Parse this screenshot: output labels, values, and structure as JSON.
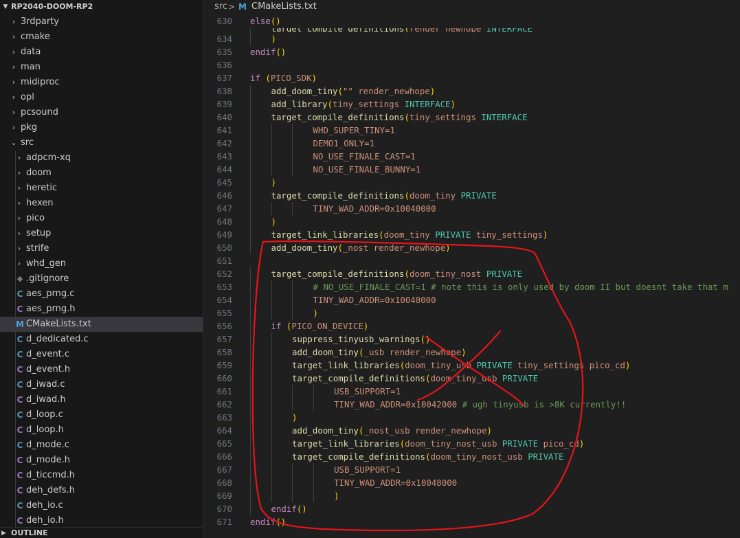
{
  "sidebar": {
    "project_name": "RP2040-DOOM-RP2",
    "outline_label": "OUTLINE",
    "items": [
      {
        "label": "3rdparty",
        "kind": "folder",
        "open": false,
        "depth": 0
      },
      {
        "label": "cmake",
        "kind": "folder",
        "open": false,
        "depth": 0
      },
      {
        "label": "data",
        "kind": "folder",
        "open": false,
        "depth": 0
      },
      {
        "label": "man",
        "kind": "folder",
        "open": false,
        "depth": 0
      },
      {
        "label": "midiproc",
        "kind": "folder",
        "open": false,
        "depth": 0
      },
      {
        "label": "opl",
        "kind": "folder",
        "open": false,
        "depth": 0
      },
      {
        "label": "pcsound",
        "kind": "folder",
        "open": false,
        "depth": 0
      },
      {
        "label": "pkg",
        "kind": "folder",
        "open": false,
        "depth": 0
      },
      {
        "label": "src",
        "kind": "folder",
        "open": true,
        "depth": 0
      },
      {
        "label": "adpcm-xq",
        "kind": "folder",
        "open": false,
        "depth": 1
      },
      {
        "label": "doom",
        "kind": "folder",
        "open": false,
        "depth": 1
      },
      {
        "label": "heretic",
        "kind": "folder",
        "open": false,
        "depth": 1
      },
      {
        "label": "hexen",
        "kind": "folder",
        "open": false,
        "depth": 1
      },
      {
        "label": "pico",
        "kind": "folder",
        "open": false,
        "depth": 1
      },
      {
        "label": "setup",
        "kind": "folder",
        "open": false,
        "depth": 1
      },
      {
        "label": "strife",
        "kind": "folder",
        "open": false,
        "depth": 1
      },
      {
        "label": "whd_gen",
        "kind": "folder",
        "open": false,
        "depth": 1
      },
      {
        "label": ".gitignore",
        "kind": "git",
        "icon": "gitignore-icon",
        "depth": 1
      },
      {
        "label": "aes_prng.c",
        "kind": "c",
        "icon_text": "C",
        "depth": 1
      },
      {
        "label": "aes_prng.h",
        "kind": "h",
        "icon_text": "C",
        "depth": 1
      },
      {
        "label": "CMakeLists.txt",
        "kind": "m",
        "icon_text": "M",
        "depth": 1,
        "selected": true
      },
      {
        "label": "d_dedicated.c",
        "kind": "c",
        "icon_text": "C",
        "depth": 1
      },
      {
        "label": "d_event.c",
        "kind": "c",
        "icon_text": "C",
        "depth": 1
      },
      {
        "label": "d_event.h",
        "kind": "h",
        "icon_text": "C",
        "depth": 1
      },
      {
        "label": "d_iwad.c",
        "kind": "c",
        "icon_text": "C",
        "depth": 1
      },
      {
        "label": "d_iwad.h",
        "kind": "h",
        "icon_text": "C",
        "depth": 1
      },
      {
        "label": "d_loop.c",
        "kind": "c",
        "icon_text": "C",
        "depth": 1
      },
      {
        "label": "d_loop.h",
        "kind": "h",
        "icon_text": "C",
        "depth": 1
      },
      {
        "label": "d_mode.c",
        "kind": "c",
        "icon_text": "C",
        "depth": 1
      },
      {
        "label": "d_mode.h",
        "kind": "h",
        "icon_text": "C",
        "depth": 1
      },
      {
        "label": "d_ticcmd.h",
        "kind": "h",
        "icon_text": "C",
        "depth": 1
      },
      {
        "label": "deh_defs.h",
        "kind": "h",
        "icon_text": "C",
        "depth": 1
      },
      {
        "label": "deh_io.c",
        "kind": "c",
        "icon_text": "C",
        "depth": 1
      },
      {
        "label": "deh_io.h",
        "kind": "h",
        "icon_text": "C",
        "depth": 1
      }
    ]
  },
  "breadcrumb": {
    "folder": "src",
    "separator": ">",
    "icon_text": "M",
    "file": "CMakeLists.txt"
  },
  "code_lines": [
    {
      "n": "630",
      "indent": 0,
      "tokens": [
        {
          "t": "else",
          "c": "kw"
        },
        {
          "t": "()",
          "c": "par"
        }
      ]
    },
    {
      "n": "",
      "indent": 4,
      "partial": true,
      "tokens": [
        {
          "t": "target_compile_definitions",
          "c": "fn"
        },
        {
          "t": "(",
          "c": "par"
        },
        {
          "t": "render_newhope ",
          "c": "arg"
        },
        {
          "t": "INTERFACE",
          "c": "con"
        }
      ]
    },
    {
      "n": "634",
      "indent": 4,
      "tokens": [
        {
          "t": ")",
          "c": "par"
        }
      ]
    },
    {
      "n": "635",
      "indent": 0,
      "tokens": [
        {
          "t": "endif",
          "c": "kw"
        },
        {
          "t": "()",
          "c": "par"
        }
      ]
    },
    {
      "n": "636",
      "indent": 0,
      "tokens": []
    },
    {
      "n": "637",
      "indent": 0,
      "tokens": [
        {
          "t": "if ",
          "c": "kw"
        },
        {
          "t": "(",
          "c": "par"
        },
        {
          "t": "PICO_SDK",
          "c": "arg"
        },
        {
          "t": ")",
          "c": "par"
        }
      ]
    },
    {
      "n": "638",
      "indent": 4,
      "tokens": [
        {
          "t": "add_doom_tiny",
          "c": "fn"
        },
        {
          "t": "(",
          "c": "par"
        },
        {
          "t": "\"\"",
          "c": "str"
        },
        {
          "t": " render_newhope",
          "c": "arg"
        },
        {
          "t": ")",
          "c": "par"
        }
      ]
    },
    {
      "n": "639",
      "indent": 4,
      "tokens": [
        {
          "t": "add_library",
          "c": "fn"
        },
        {
          "t": "(",
          "c": "par"
        },
        {
          "t": "tiny_settings ",
          "c": "arg"
        },
        {
          "t": "INTERFACE",
          "c": "con"
        },
        {
          "t": ")",
          "c": "par"
        }
      ]
    },
    {
      "n": "640",
      "indent": 4,
      "tokens": [
        {
          "t": "target_compile_definitions",
          "c": "fn"
        },
        {
          "t": "(",
          "c": "par"
        },
        {
          "t": "tiny_settings ",
          "c": "arg"
        },
        {
          "t": "INTERFACE",
          "c": "con"
        }
      ]
    },
    {
      "n": "641",
      "indent": 12,
      "tokens": [
        {
          "t": "WHD_SUPER_TINY=1",
          "c": "arg"
        }
      ]
    },
    {
      "n": "642",
      "indent": 12,
      "tokens": [
        {
          "t": "DEMO1_ONLY=1",
          "c": "arg"
        }
      ]
    },
    {
      "n": "643",
      "indent": 12,
      "tokens": [
        {
          "t": "NO_USE_FINALE_CAST=1",
          "c": "arg"
        }
      ]
    },
    {
      "n": "644",
      "indent": 12,
      "tokens": [
        {
          "t": "NO_USE_FINALE_BUNNY=1",
          "c": "arg"
        }
      ]
    },
    {
      "n": "645",
      "indent": 4,
      "tokens": [
        {
          "t": ")",
          "c": "par"
        }
      ]
    },
    {
      "n": "646",
      "indent": 4,
      "tokens": [
        {
          "t": "target_compile_definitions",
          "c": "fn"
        },
        {
          "t": "(",
          "c": "par"
        },
        {
          "t": "doom_tiny ",
          "c": "arg"
        },
        {
          "t": "PRIVATE",
          "c": "con"
        }
      ]
    },
    {
      "n": "647",
      "indent": 12,
      "tokens": [
        {
          "t": "TINY_WAD_ADDR=0x10040000",
          "c": "arg"
        }
      ]
    },
    {
      "n": "648",
      "indent": 4,
      "tokens": [
        {
          "t": ")",
          "c": "par"
        }
      ]
    },
    {
      "n": "649",
      "indent": 4,
      "tokens": [
        {
          "t": "target_link_libraries",
          "c": "fn"
        },
        {
          "t": "(",
          "c": "par"
        },
        {
          "t": "doom_tiny ",
          "c": "arg"
        },
        {
          "t": "PRIVATE",
          "c": "con"
        },
        {
          "t": " tiny_settings",
          "c": "arg"
        },
        {
          "t": ")",
          "c": "par"
        }
      ]
    },
    {
      "n": "650",
      "indent": 4,
      "tokens": [
        {
          "t": "add_doom_tiny",
          "c": "fn"
        },
        {
          "t": "(",
          "c": "par"
        },
        {
          "t": "_nost render_newhope",
          "c": "arg"
        },
        {
          "t": ")",
          "c": "par"
        }
      ]
    },
    {
      "n": "651",
      "indent": 0,
      "tokens": []
    },
    {
      "n": "652",
      "indent": 4,
      "tokens": [
        {
          "t": "target_compile_definitions",
          "c": "fn"
        },
        {
          "t": "(",
          "c": "par"
        },
        {
          "t": "doom_tiny_nost ",
          "c": "arg"
        },
        {
          "t": "PRIVATE",
          "c": "con"
        }
      ]
    },
    {
      "n": "653",
      "indent": 12,
      "tokens": [
        {
          "t": "# NO_USE_FINALE_CAST=1 # note this is only used by doom II but doesnt take that m",
          "c": "cmt"
        }
      ]
    },
    {
      "n": "654",
      "indent": 12,
      "tokens": [
        {
          "t": "TINY_WAD_ADDR=0x10048000",
          "c": "arg"
        }
      ]
    },
    {
      "n": "655",
      "indent": 12,
      "tokens": [
        {
          "t": ")",
          "c": "par"
        }
      ]
    },
    {
      "n": "656",
      "indent": 4,
      "tokens": [
        {
          "t": "if ",
          "c": "kw"
        },
        {
          "t": "(",
          "c": "par"
        },
        {
          "t": "PICO_ON_DEVICE",
          "c": "arg"
        },
        {
          "t": ")",
          "c": "par"
        }
      ]
    },
    {
      "n": "657",
      "indent": 8,
      "tokens": [
        {
          "t": "suppress_tinyusb_warnings",
          "c": "fn"
        },
        {
          "t": "()",
          "c": "par"
        }
      ]
    },
    {
      "n": "658",
      "indent": 8,
      "tokens": [
        {
          "t": "add_doom_tiny",
          "c": "fn"
        },
        {
          "t": "(",
          "c": "par"
        },
        {
          "t": "_usb render_newhope",
          "c": "arg"
        },
        {
          "t": ")",
          "c": "par"
        }
      ]
    },
    {
      "n": "659",
      "indent": 8,
      "tokens": [
        {
          "t": "target_link_libraries",
          "c": "fn"
        },
        {
          "t": "(",
          "c": "par"
        },
        {
          "t": "doom_tiny_usb ",
          "c": "arg"
        },
        {
          "t": "PRIVATE",
          "c": "con"
        },
        {
          "t": " tiny_settings pico_cd",
          "c": "arg"
        },
        {
          "t": ")",
          "c": "par"
        }
      ]
    },
    {
      "n": "660",
      "indent": 8,
      "tokens": [
        {
          "t": "target_compile_definitions",
          "c": "fn"
        },
        {
          "t": "(",
          "c": "par"
        },
        {
          "t": "doom_tiny_usb ",
          "c": "arg"
        },
        {
          "t": "PRIVATE",
          "c": "con"
        }
      ]
    },
    {
      "n": "661",
      "indent": 16,
      "tokens": [
        {
          "t": "USB_SUPPORT=1",
          "c": "arg"
        }
      ]
    },
    {
      "n": "662",
      "indent": 16,
      "tokens": [
        {
          "t": "TINY_WAD_ADDR=0x10042000 ",
          "c": "arg"
        },
        {
          "t": "# ugh tinyusb is >8K currently!!",
          "c": "cmt"
        }
      ]
    },
    {
      "n": "663",
      "indent": 8,
      "tokens": [
        {
          "t": ")",
          "c": "par"
        }
      ]
    },
    {
      "n": "664",
      "indent": 8,
      "tokens": [
        {
          "t": "add_doom_tiny",
          "c": "fn"
        },
        {
          "t": "(",
          "c": "par"
        },
        {
          "t": "_nost_usb render_newhope",
          "c": "arg"
        },
        {
          "t": ")",
          "c": "par"
        }
      ]
    },
    {
      "n": "665",
      "indent": 8,
      "tokens": [
        {
          "t": "target_link_libraries",
          "c": "fn"
        },
        {
          "t": "(",
          "c": "par"
        },
        {
          "t": "doom_tiny_nost_usb ",
          "c": "arg"
        },
        {
          "t": "PRIVATE",
          "c": "con"
        },
        {
          "t": " pico_cd",
          "c": "arg"
        },
        {
          "t": ")",
          "c": "par"
        }
      ]
    },
    {
      "n": "666",
      "indent": 8,
      "tokens": [
        {
          "t": "target_compile_definitions",
          "c": "fn"
        },
        {
          "t": "(",
          "c": "par"
        },
        {
          "t": "doom_tiny_nost_usb ",
          "c": "arg"
        },
        {
          "t": "PRIVATE",
          "c": "con"
        }
      ]
    },
    {
      "n": "667",
      "indent": 16,
      "tokens": [
        {
          "t": "USB_SUPPORT=1",
          "c": "arg"
        }
      ]
    },
    {
      "n": "668",
      "indent": 16,
      "tokens": [
        {
          "t": "TINY_WAD_ADDR=0x10048000",
          "c": "arg"
        }
      ]
    },
    {
      "n": "669",
      "indent": 16,
      "tokens": [
        {
          "t": ")",
          "c": "par"
        }
      ]
    },
    {
      "n": "670",
      "indent": 4,
      "tokens": [
        {
          "t": "endif",
          "c": "kw"
        },
        {
          "t": "()",
          "c": "par"
        }
      ]
    },
    {
      "n": "671",
      "indent": 0,
      "tokens": [
        {
          "t": "endif",
          "c": "kw"
        },
        {
          "t": "()",
          "c": "par"
        }
      ]
    }
  ],
  "annotation": {
    "color": "#e8141a"
  }
}
